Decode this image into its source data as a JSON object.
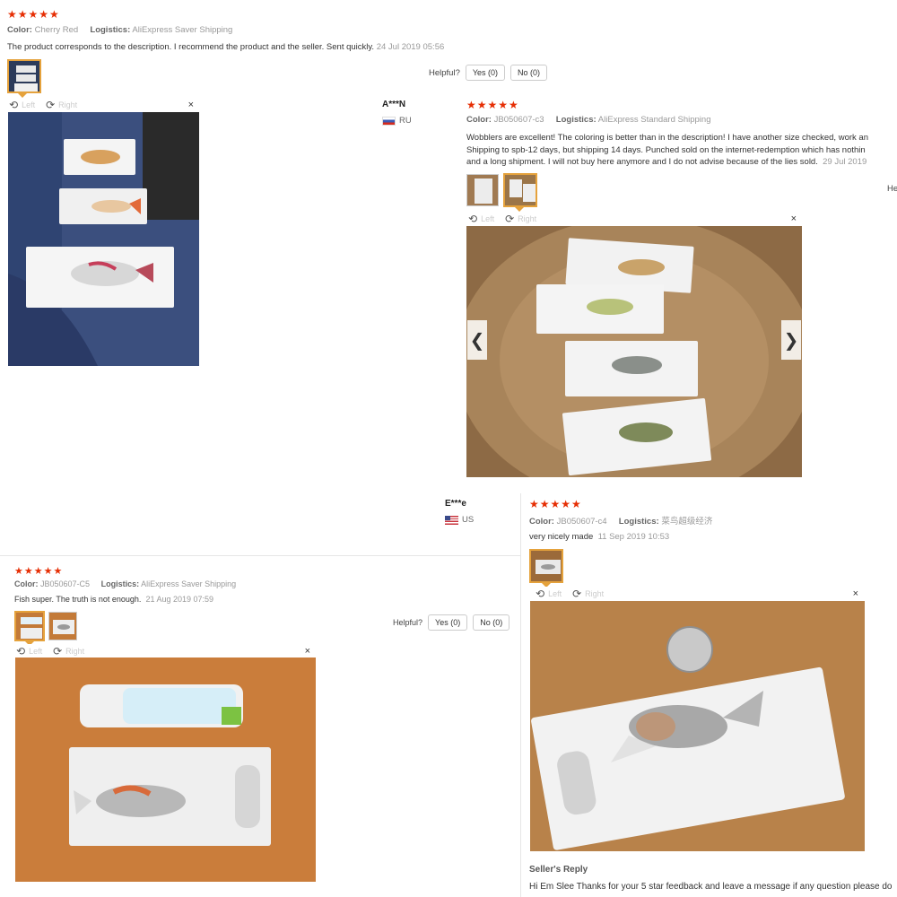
{
  "review_top": {
    "stars": "★★★★★",
    "color_label": "Color:",
    "color_value": "Cherry Red",
    "logistics_label": "Logistics:",
    "logistics_value": "AliExpress Saver Shipping",
    "text": "The product corresponds to the description. I recommend the product and the seller. Sent quickly.",
    "date": "24 Jul 2019 05:56",
    "helpful_label": "Helpful?",
    "yes_label": "Yes (0)",
    "no_label": "No (0)",
    "viewer": {
      "left_label": "Left",
      "right_label": "Right",
      "close": "×"
    }
  },
  "review_an": {
    "author": "A***N",
    "country": "RU",
    "stars": "★★★★★",
    "color_label": "Color:",
    "color_value": "JB050607-c3",
    "logistics_label": "Logistics:",
    "logistics_value": "AliExpress Standard Shipping",
    "text_lines": [
      "Wobblers are excellent! The coloring is better than in the description! I have another size checked, work an",
      "Shipping to spb-12 days, but shipping 14 days. Punched sold on the internet-redemption which has nothin",
      "and a long shipment. I will not buy here anymore and I do not advise because of the lies sold."
    ],
    "date": "29 Jul 2019",
    "helpful_partial": "He",
    "viewer": {
      "left_label": "Left",
      "right_label": "Right",
      "close": "×"
    },
    "nav": {
      "prev": "❮",
      "next": "❯"
    }
  },
  "review_ee": {
    "author": "E***e",
    "country": "US",
    "stars": "★★★★★",
    "color_label": "Color:",
    "color_value": "JB050607-c4",
    "logistics_label": "Logistics:",
    "logistics_value": "菜鸟超级经济",
    "text": "very nicely made",
    "date": "11 Sep 2019 10:53",
    "viewer": {
      "left_label": "Left",
      "right_label": "Right",
      "close": "×"
    },
    "seller_reply_title": "Seller's Reply",
    "seller_reply_text": "Hi Em Slee Thanks for your 5 star feedback and leave a message if any question please do"
  },
  "review_c5": {
    "stars": "★★★★★",
    "color_label": "Color:",
    "color_value": "JB050607-C5",
    "logistics_label": "Logistics:",
    "logistics_value": "AliExpress Saver Shipping",
    "text": "Fish super. The truth is not enough.",
    "date": "21 Aug 2019 07:59",
    "helpful_label": "Helpful?",
    "yes_label": "Yes (0)",
    "no_label": "No (0)",
    "viewer": {
      "left_label": "Left",
      "right_label": "Right",
      "close": "×"
    }
  },
  "icons": {
    "rotate_left": "⟲",
    "rotate_right": "⟳"
  },
  "colors": {
    "star": "#e62e04",
    "thumb_active_border": "#e5a23c",
    "meta_gray": "#999999"
  }
}
